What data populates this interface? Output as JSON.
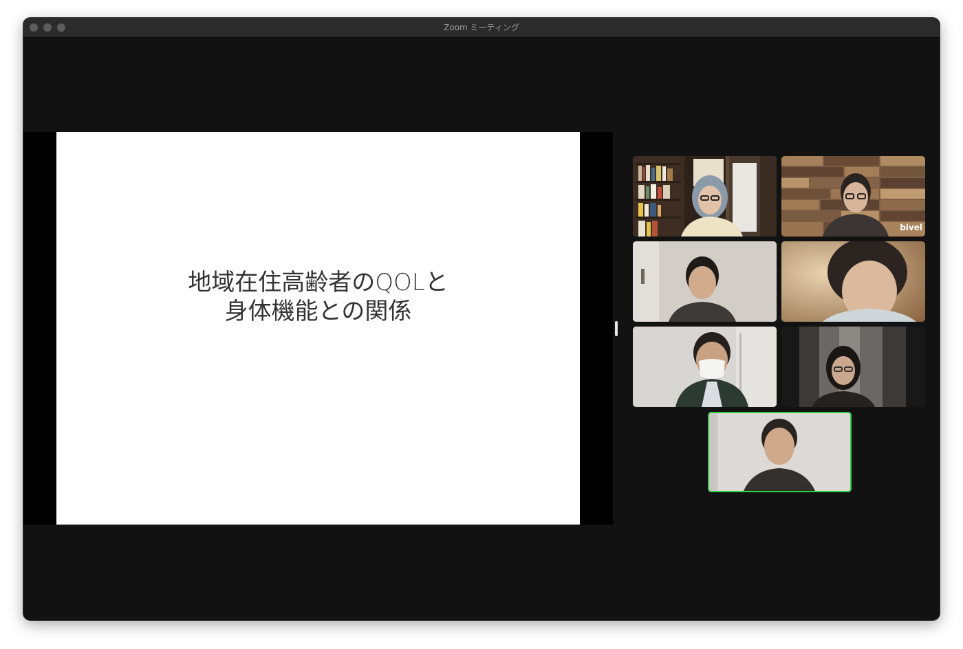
{
  "window": {
    "title": "Zoom ミーティング"
  },
  "shared_screen": {
    "slide_title_lines": [
      "地域在住高齢者のQOLと",
      "身体機能との関係"
    ]
  },
  "participants": [
    {
      "tile": 1,
      "active_speaker": false,
      "background": "bookshelf"
    },
    {
      "tile": 2,
      "active_speaker": false,
      "background": "wood-wall",
      "wall_label": "bivel"
    },
    {
      "tile": 3,
      "active_speaker": false,
      "background": "room"
    },
    {
      "tile": 4,
      "active_speaker": false,
      "background": "room"
    },
    {
      "tile": 5,
      "active_speaker": false,
      "background": "room"
    },
    {
      "tile": 6,
      "active_speaker": false,
      "background": "dark-room"
    },
    {
      "tile": 7,
      "active_speaker": true,
      "background": "room"
    }
  ],
  "colors": {
    "active_speaker_border": "#2ed34a",
    "meeting_background": "#121212"
  }
}
